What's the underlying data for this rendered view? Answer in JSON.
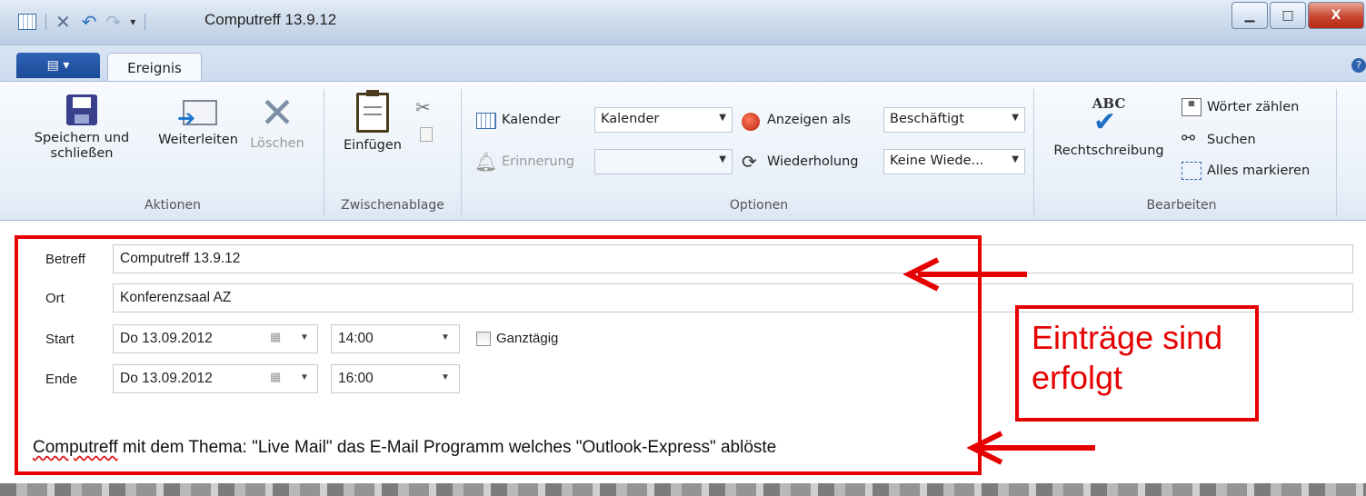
{
  "window": {
    "title": "Computreff 13.9.12",
    "buttons": {
      "minimize": "▁",
      "maximize": "□",
      "close": "X"
    }
  },
  "ribbon": {
    "file_tab": "▤ ▾",
    "active_tab": "Ereignis",
    "help": "?",
    "groups": {
      "aktionen": {
        "label": "Aktionen",
        "save_close": "Speichern und schließen",
        "forward": "Weiterleiten",
        "delete": "Löschen"
      },
      "zwischenablage": {
        "label": "Zwischenablage",
        "paste": "Einfügen"
      },
      "optionen": {
        "label": "Optionen",
        "calendar_label": "Kalender",
        "calendar_value": "Kalender",
        "show_as_label": "Anzeigen als",
        "show_as_value": "Beschäftigt",
        "reminder_label": "Erinnerung",
        "reminder_value": "",
        "recurrence_label": "Wiederholung",
        "recurrence_value": "Keine Wiede..."
      },
      "bearbeiten": {
        "label": "Bearbeiten",
        "spelling": "Rechtschreibung",
        "spelling_icon_text": "ABC",
        "word_count": "Wörter zählen",
        "search": "Suchen",
        "select_all": "Alles markieren"
      }
    }
  },
  "form": {
    "subject_label": "Betreff",
    "subject_value": "Computreff 13.9.12",
    "location_label": "Ort",
    "location_value": "Konferenzsaal AZ",
    "start_label": "Start",
    "start_date": "Do 13.09.2012",
    "start_time": "14:00",
    "all_day_label": "Ganztägig",
    "end_label": "Ende",
    "end_date": "Do 13.09.2012",
    "end_time": "16:00",
    "body_word1": "Computreff",
    "body_rest": " mit dem Thema: \"Live Mail\" das E-Mail Programm welches \"Outlook-Express\" ablöste"
  },
  "annotation": {
    "text_line1": "Einträge sind",
    "text_line2": "erfolgt",
    "color": "#e60000"
  }
}
